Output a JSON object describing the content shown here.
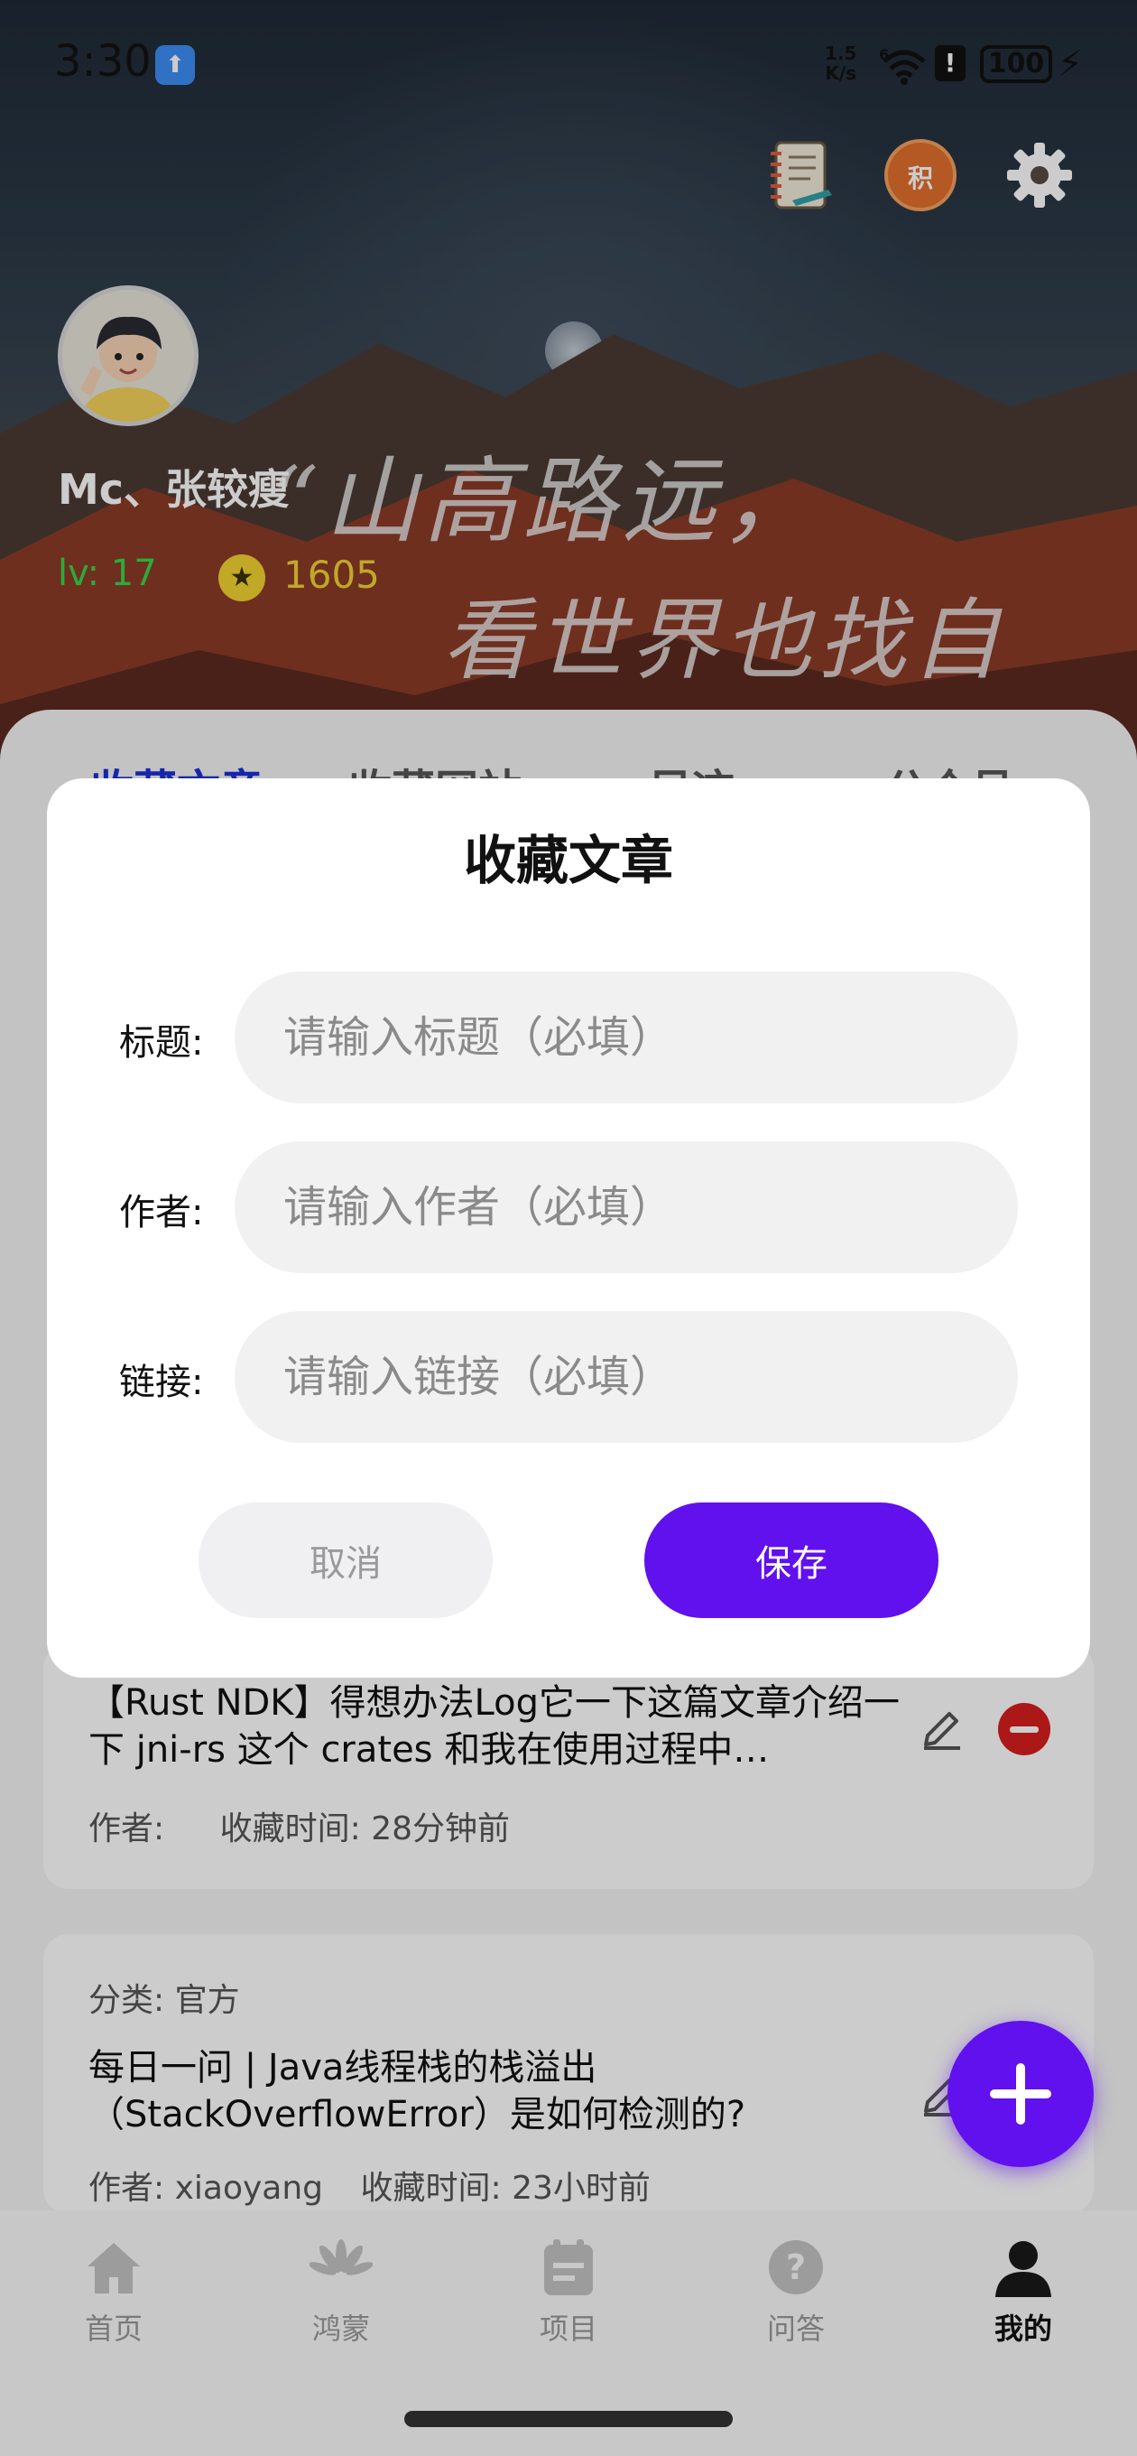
{
  "status_bar": {
    "time": "3:30",
    "net_speed_value": "1.5",
    "net_speed_unit": "K/s",
    "battery": "100",
    "app_icon": "upload-arrow-icon",
    "network_label": "6"
  },
  "header": {
    "calligraphy_line1": "“山高路远，",
    "calligraphy_line2": "看世界也找自己。”",
    "coin_shop_glyph": "积",
    "icons": [
      "notebook-icon",
      "coin-shop-icon",
      "gear-icon"
    ]
  },
  "profile": {
    "username": "Mc、张较瘦",
    "level_label": "lv:  17",
    "coin_icon_glyph": "★",
    "coins": "1605"
  },
  "tabs": [
    {
      "label": "收藏文章",
      "active": true
    },
    {
      "label": "收藏网站",
      "active": false
    },
    {
      "label": "足迹",
      "active": false
    },
    {
      "label": "公众号",
      "active": false
    }
  ],
  "articles": [
    {
      "title": "【Rust NDK】得想办法Log它一下这篇文章介绍一下 jni-rs 这个 crates 和我在使用过程中…",
      "author_label": "作者:",
      "author": "",
      "time_label": "收藏时间:",
      "time": "28分钟前"
    },
    {
      "category_label": "分类:",
      "category": "官方",
      "title": "每日一问 | Java线程栈的栈溢出（StackOverflowError）是如何检测的?",
      "author_label": "作者:",
      "author": "xiaoyang",
      "time_label": "收藏时间:",
      "time": "23小时前"
    }
  ],
  "dialog": {
    "title": "收藏文章",
    "fields": [
      {
        "label": "标题:",
        "placeholder": "请输入标题（必填）",
        "value": ""
      },
      {
        "label": "作者:",
        "placeholder": "请输入作者（必填）",
        "value": ""
      },
      {
        "label": "链接:",
        "placeholder": "请输入链接（必填）",
        "value": ""
      }
    ],
    "cancel_label": "取消",
    "save_label": "保存"
  },
  "bottom_nav": [
    {
      "label": "首页",
      "icon": "home-icon",
      "active": false
    },
    {
      "label": "鸿蒙",
      "icon": "huawei-icon",
      "active": false
    },
    {
      "label": "项目",
      "icon": "project-icon",
      "active": false
    },
    {
      "label": "问答",
      "icon": "question-icon",
      "active": false
    },
    {
      "label": "我的",
      "icon": "person-icon",
      "active": true
    }
  ],
  "colors": {
    "accent": "#6110ee",
    "tab_active": "#1c2fd6",
    "level_green": "#38d64a",
    "coin_yellow": "#f2d231",
    "remove_red": "#d81e1e"
  }
}
